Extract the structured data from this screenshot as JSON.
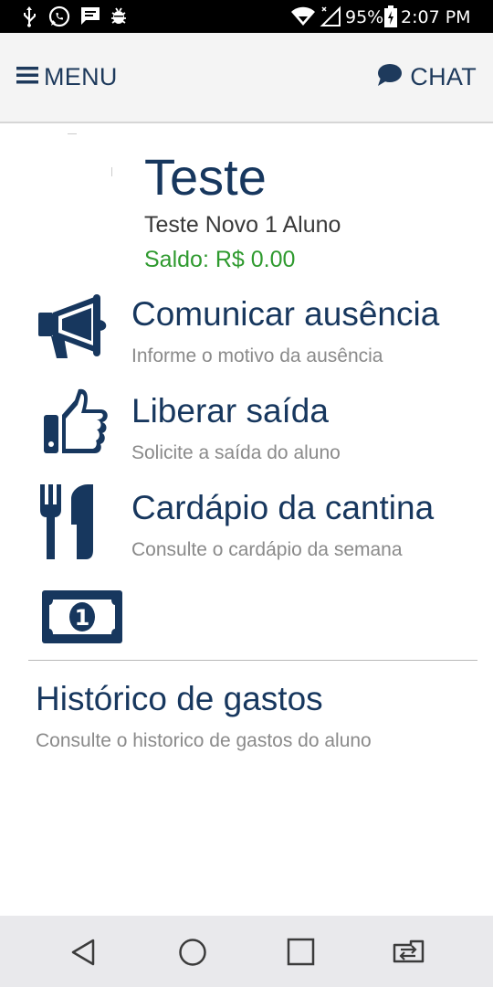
{
  "status_bar": {
    "battery": "95%",
    "time": "2:07 PM",
    "icons": [
      "usb-icon",
      "whatsapp-icon",
      "message-icon",
      "bug-icon",
      "wifi-icon",
      "signal-icon",
      "battery-icon"
    ]
  },
  "app_bar": {
    "menu_label": "MENU",
    "chat_label": "CHAT",
    "icons": [
      "hamburger-icon",
      "chat-bubble-icon"
    ]
  },
  "profile": {
    "name": "Teste",
    "subtitle": "Teste Novo 1 Aluno",
    "balance": "Saldo: R$ 0.00"
  },
  "menu_items": [
    {
      "icon": "megaphone-icon",
      "title": "Comunicar ausência",
      "description": "Informe o motivo da ausência"
    },
    {
      "icon": "thumbs-up-icon",
      "title": "Liberar saída",
      "description": "Solicite a saída do aluno"
    },
    {
      "icon": "fork-knife-icon",
      "title": "Cardápio da cantina",
      "description": "Consulte o cardápio da semana"
    },
    {
      "icon": "money-icon",
      "title": "Histórico de gastos",
      "description": "Consulte o historico de gastos do aluno"
    }
  ],
  "nav_bar": {
    "icons": [
      "back-icon",
      "home-icon",
      "recents-icon",
      "switch-apps-icon"
    ]
  },
  "colors": {
    "primary": "#17375e",
    "balance_green": "#2f9a2f",
    "secondary_text": "#8a8a8a",
    "app_bar_bg": "#f4f4f4",
    "nav_bar_bg": "#e9e9ec"
  }
}
